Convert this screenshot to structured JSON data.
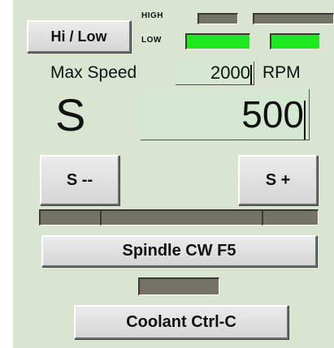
{
  "buttons": {
    "hi_low": "Hi / Low",
    "s_minus": "S --",
    "s_plus": "S +",
    "spindle": "Spindle CW F5",
    "coolant": "Coolant Ctrl-C"
  },
  "range_indicator": {
    "high_label": "HIGH",
    "low_label": "LOW",
    "high_active": false,
    "low_active": true
  },
  "max_speed": {
    "label": "Max Speed",
    "value": "2000",
    "unit": "RPM"
  },
  "spindle_speed": {
    "label": "S",
    "value": "500"
  },
  "colors": {
    "panel_bg": "#d9e4d1",
    "led_on": "#1ee81e",
    "led_off": "#757368"
  }
}
